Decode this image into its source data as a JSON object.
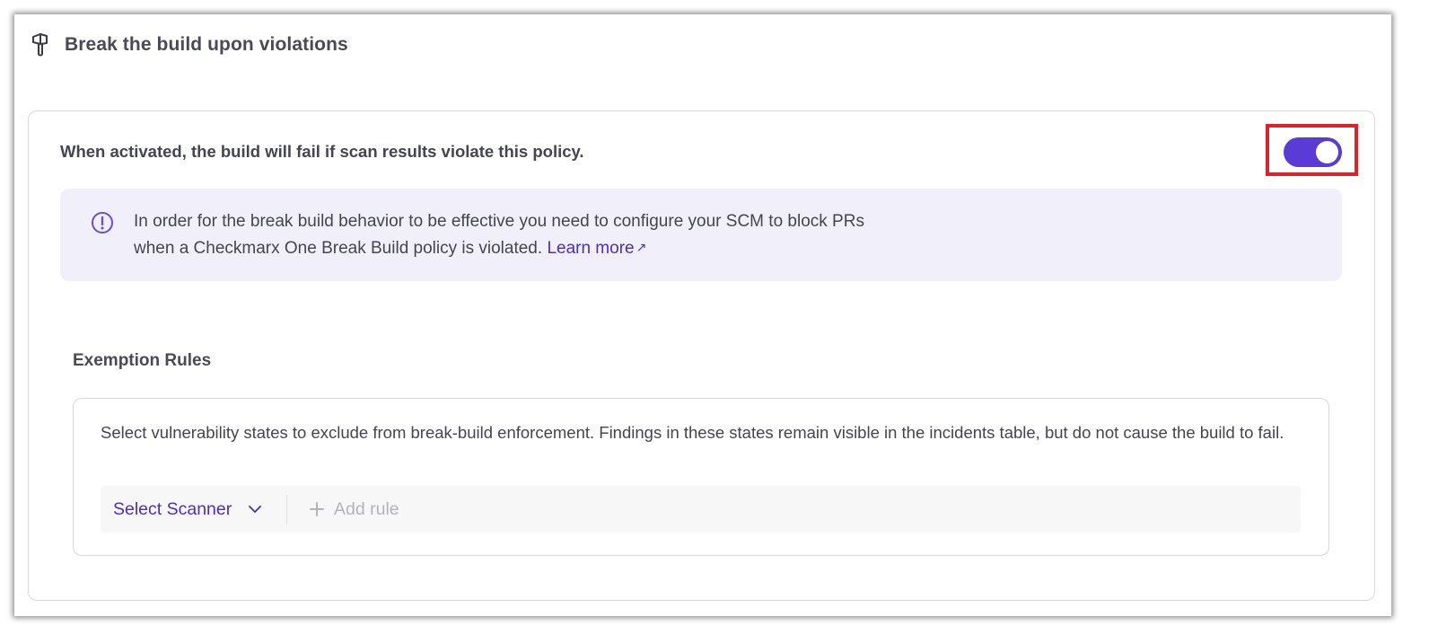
{
  "section": {
    "title": "Break the build upon violations",
    "icon": "hammer-icon"
  },
  "activation": {
    "text": "When activated, the build will fail if scan results violate this policy.",
    "toggle_on": true,
    "toggle_color": "#5a3bd6",
    "highlight_color": "#e0202a"
  },
  "info": {
    "line1": "In order for the break build behavior to be effective you need to configure your SCM to block PRs",
    "line2": "when a Checkmarx One Break Build policy is violated.",
    "link_label": "Learn more",
    "link_icon": "↗",
    "background": "#f1f0fa"
  },
  "exemption": {
    "title": "Exemption Rules",
    "description": "Select vulnerability states to exclude from break-build enforcement. Findings in these states remain visible in the incidents table, but do not cause the build to fail.",
    "select_scanner_label": "Select Scanner",
    "add_rule_label": "Add rule"
  }
}
